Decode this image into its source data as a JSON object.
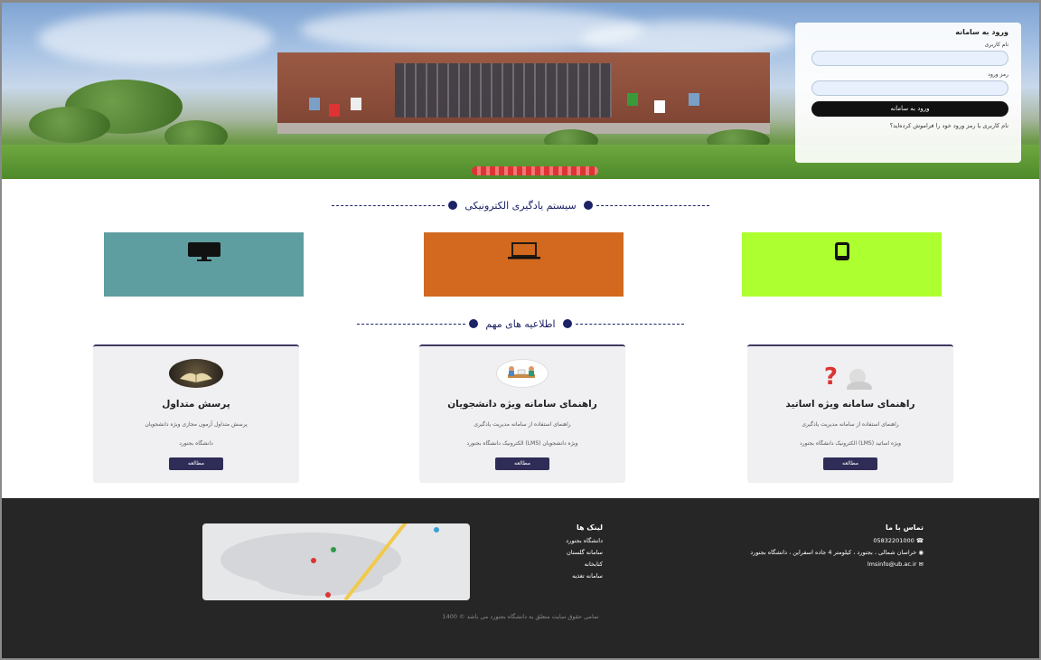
{
  "login": {
    "title": "ورود به سامانه",
    "username_label": "نام کاربری",
    "password_label": "رمز ورود",
    "submit_label": "ورود به سامانه",
    "forgot_text": "نام کاربری یا رمز ورود خود را فراموش کرده‌اید؟"
  },
  "section1": {
    "title": "سیستم یادگیری الکترونیکی"
  },
  "devices": [
    {
      "icon": "tablet-icon",
      "color": "#adff2f"
    },
    {
      "icon": "laptop-icon",
      "color": "#d2691e"
    },
    {
      "icon": "monitor-icon",
      "color": "#5f9ea0"
    }
  ],
  "section2": {
    "title": "اطلاعیه های مهم"
  },
  "cards": [
    {
      "title": "راهنمای سامانه ویژه اساتید",
      "desc": "راهنمای استفاده از سامانه مدیریت یادگیری",
      "desc2": "ویژه اساتید (LMS) الکترونیک دانشگاه بجنورد",
      "button": "مطالعه",
      "icon": "question-person-icon"
    },
    {
      "title": "راهنمای سامانه ویژه دانشجویان",
      "desc": "راهنمای استفاده از سامانه مدیریت یادگیری",
      "desc2": "ویژه دانشجویان (LMS) الکترونیک دانشگاه بجنورد",
      "button": "مطالعه",
      "icon": "meeting-icon"
    },
    {
      "title": "پرسش متداول",
      "desc": "پرسش متداول آزمون مجازی ویژه دانشجویان",
      "desc2": "دانشگاه بجنورد",
      "button": "مطالعه",
      "icon": "book-icon"
    }
  ],
  "footer": {
    "contact": {
      "title": "تماس با ما",
      "phone": "05832201000",
      "address": "خراسان شمالی ، بجنورد ، کیلومتر 4 جاده اسفراین ، دانشگاه بجنورد",
      "email": "lmsinfo@ub.ac.ir"
    },
    "links": {
      "title": "لینک ها",
      "items": [
        "دانشگاه بجنورد",
        "سامانه گلستان",
        "کتابخانه",
        "سامانه تغذیه"
      ]
    },
    "copyright": "تمامی حقوق سایت متعلق به دانشگاه بجنورد می باشد © 1400"
  }
}
